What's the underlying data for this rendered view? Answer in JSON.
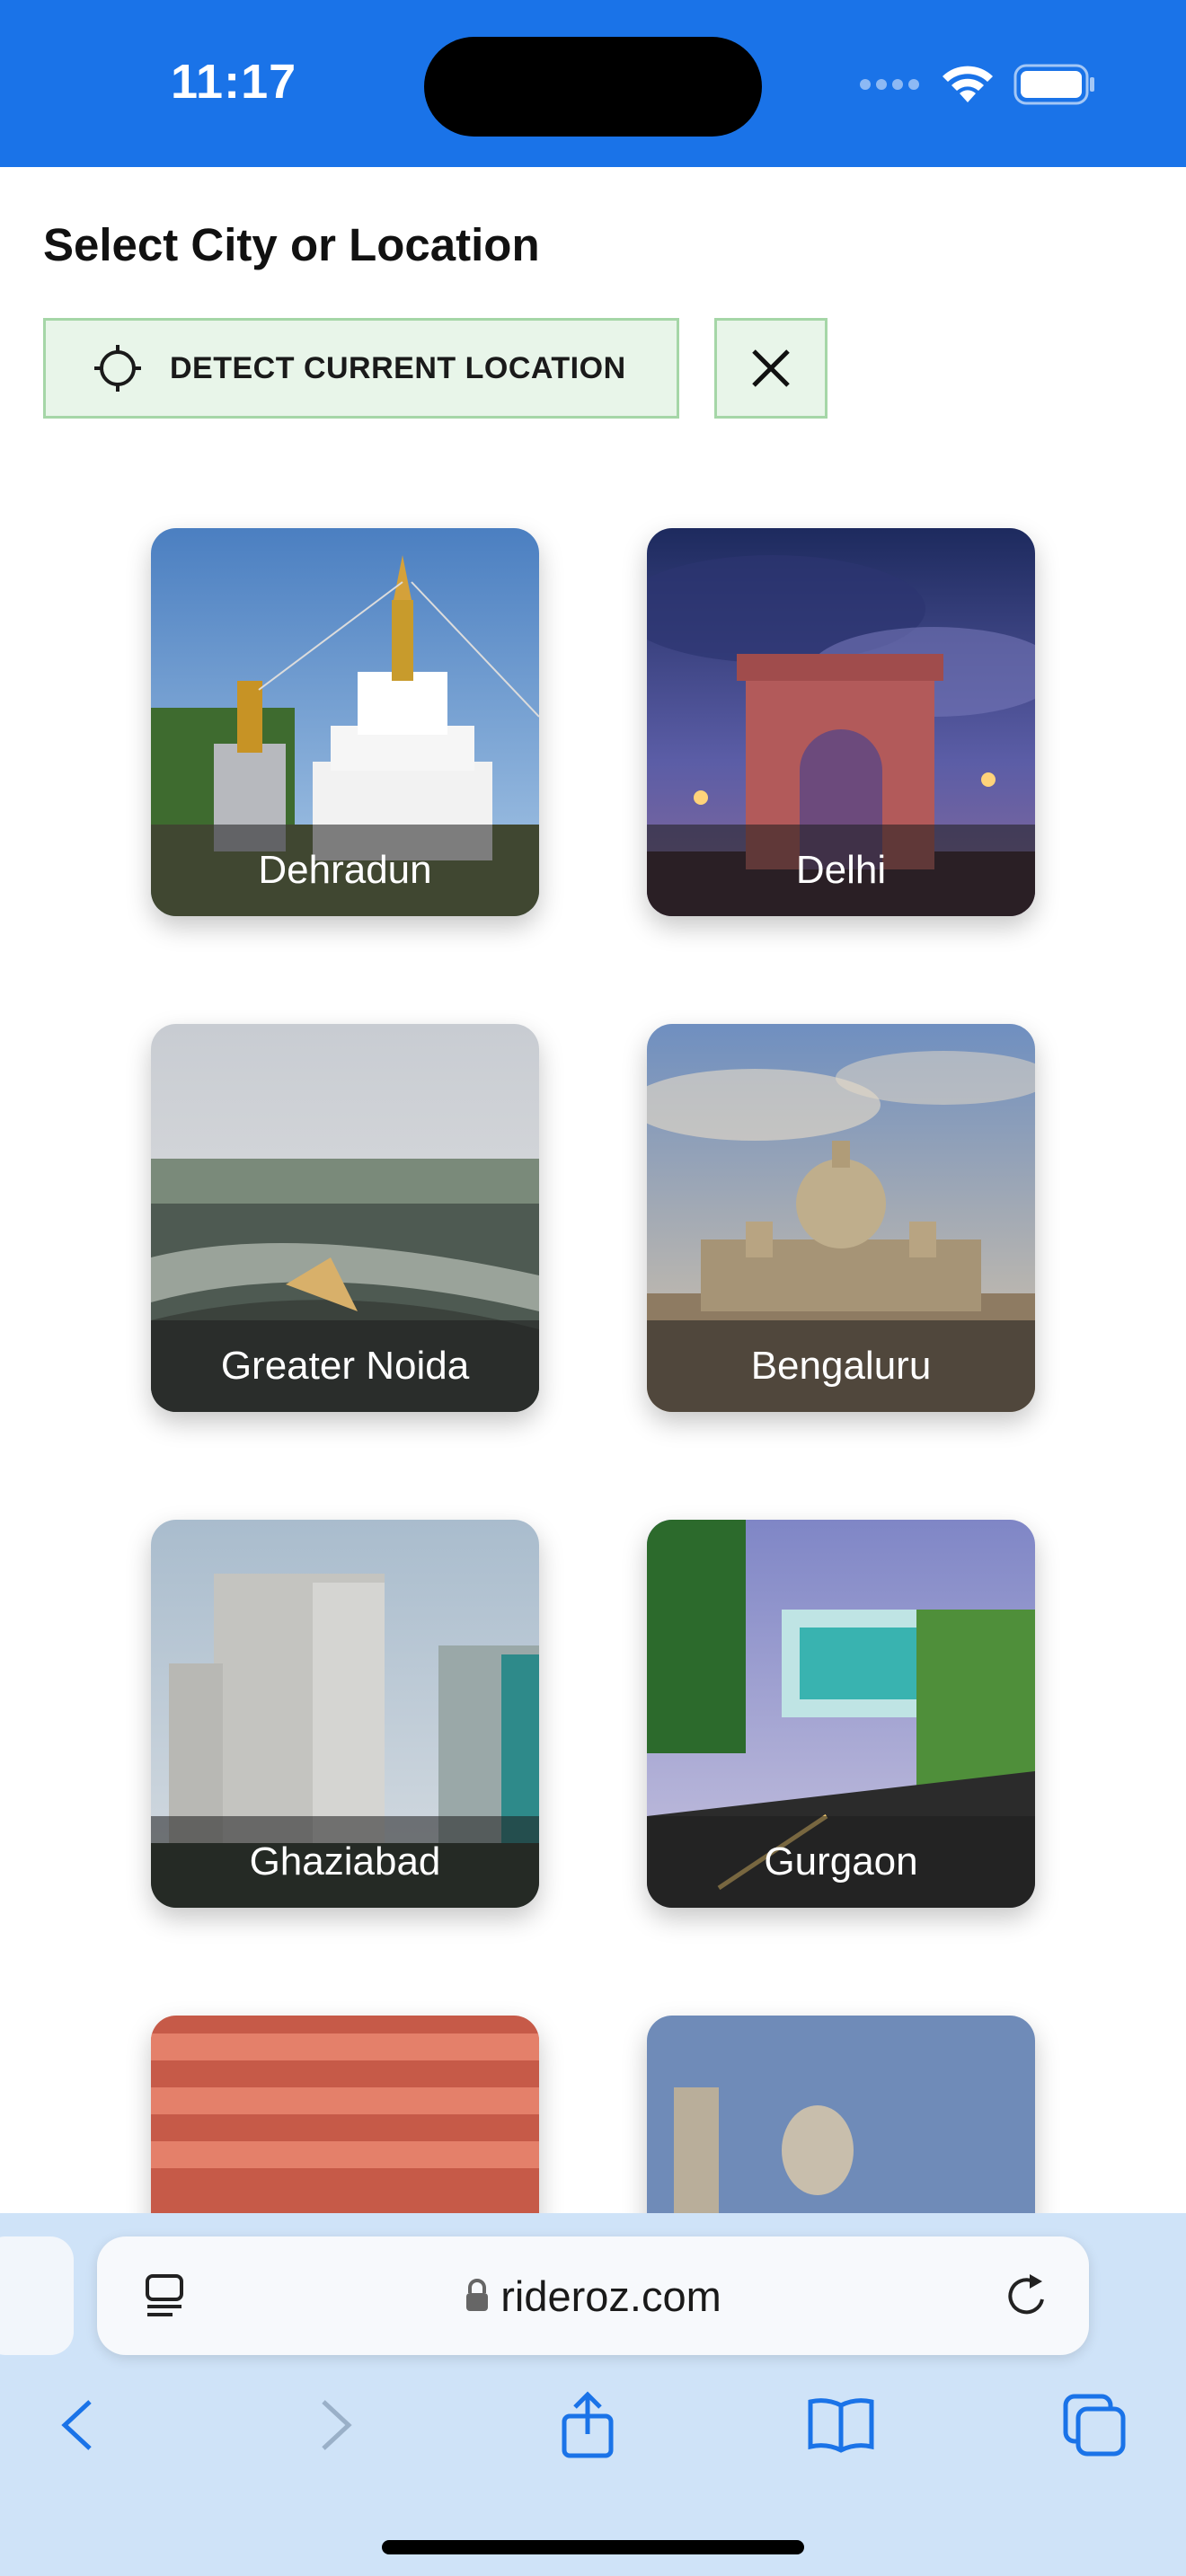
{
  "status": {
    "time": "11:17"
  },
  "header": {
    "title": "Select City or Location",
    "detect_label": "DETECT CURRENT LOCATION"
  },
  "cities": [
    {
      "name": "Dehradun"
    },
    {
      "name": "Delhi"
    },
    {
      "name": "Greater Noida"
    },
    {
      "name": "Bengaluru"
    },
    {
      "name": "Ghaziabad"
    },
    {
      "name": "Gurgaon"
    }
  ],
  "browser": {
    "url": "rideroz.com"
  },
  "colors": {
    "status_bar": "#1a73e8",
    "button_bg": "#e8f5e9",
    "button_border": "#a5d6a7",
    "browser_bar": "#cfe3f8",
    "toolbar_icon": "#1a73e8"
  }
}
